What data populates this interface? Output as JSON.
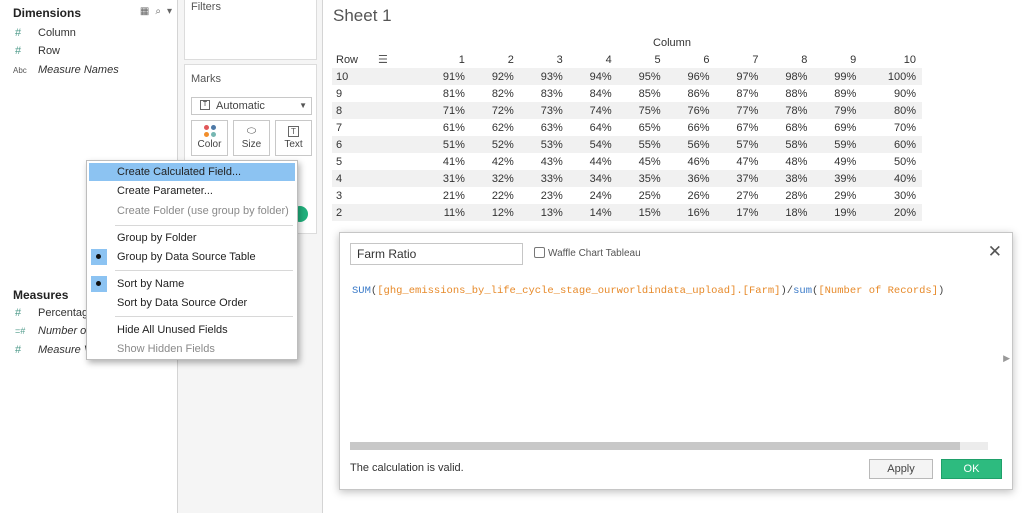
{
  "data_pane": {
    "dimensions_title": "Dimensions",
    "dimensions": [
      {
        "icon": "#",
        "label": "Column"
      },
      {
        "icon": "#",
        "label": "Row"
      },
      {
        "icon": "Abc",
        "label": "Measure Names"
      }
    ],
    "measures_title": "Measures",
    "measures": [
      {
        "icon": "#",
        "label": "Percentag"
      },
      {
        "icon": "=#",
        "label": "Number o"
      },
      {
        "icon": "#",
        "label": "Measure V"
      }
    ]
  },
  "shelves": {
    "filters_title": "Filters",
    "marks_title": "Marks",
    "mark_type": "Automatic",
    "mark_buttons": {
      "color": "Color",
      "size": "Size",
      "text": "Text"
    }
  },
  "sheet": {
    "title": "Sheet 1",
    "column_header": "Column",
    "row_header": "Row",
    "columns": [
      "1",
      "2",
      "3",
      "4",
      "5",
      "6",
      "7",
      "8",
      "9",
      "10"
    ],
    "rows": [
      {
        "row": "10",
        "cells": [
          "91%",
          "92%",
          "93%",
          "94%",
          "95%",
          "96%",
          "97%",
          "98%",
          "99%",
          "100%"
        ]
      },
      {
        "row": "9",
        "cells": [
          "81%",
          "82%",
          "83%",
          "84%",
          "85%",
          "86%",
          "87%",
          "88%",
          "89%",
          "90%"
        ]
      },
      {
        "row": "8",
        "cells": [
          "71%",
          "72%",
          "73%",
          "74%",
          "75%",
          "76%",
          "77%",
          "78%",
          "79%",
          "80%"
        ]
      },
      {
        "row": "7",
        "cells": [
          "61%",
          "62%",
          "63%",
          "64%",
          "65%",
          "66%",
          "67%",
          "68%",
          "69%",
          "70%"
        ]
      },
      {
        "row": "6",
        "cells": [
          "51%",
          "52%",
          "53%",
          "54%",
          "55%",
          "56%",
          "57%",
          "58%",
          "59%",
          "60%"
        ]
      },
      {
        "row": "5",
        "cells": [
          "41%",
          "42%",
          "43%",
          "44%",
          "45%",
          "46%",
          "47%",
          "48%",
          "49%",
          "50%"
        ]
      },
      {
        "row": "4",
        "cells": [
          "31%",
          "32%",
          "33%",
          "34%",
          "35%",
          "36%",
          "37%",
          "38%",
          "39%",
          "40%"
        ]
      },
      {
        "row": "3",
        "cells": [
          "21%",
          "22%",
          "23%",
          "24%",
          "25%",
          "26%",
          "27%",
          "28%",
          "29%",
          "30%"
        ]
      },
      {
        "row": "2",
        "cells": [
          "11%",
          "12%",
          "13%",
          "14%",
          "15%",
          "16%",
          "17%",
          "18%",
          "19%",
          "20%"
        ]
      }
    ]
  },
  "context_menu": {
    "items": [
      {
        "label": "Create Calculated Field...",
        "state": "highlighted"
      },
      {
        "label": "Create Parameter...",
        "state": "normal"
      },
      {
        "label": "Create Folder (use group by folder)",
        "state": "disabled"
      },
      {
        "label": "Group by Folder",
        "state": "normal"
      },
      {
        "label": "Group by Data Source Table",
        "state": "checked"
      },
      {
        "label": "Sort by Name",
        "state": "checked"
      },
      {
        "label": "Sort by Data Source Order",
        "state": "normal"
      },
      {
        "label": "Hide All Unused Fields",
        "state": "normal"
      },
      {
        "label": "Show Hidden Fields",
        "state": "disabled"
      }
    ]
  },
  "calc_dialog": {
    "name": "Farm Ratio",
    "data_source": "Waffle Chart Tableau",
    "formula": {
      "f1": "SUM",
      "p1": "(",
      "field1": "[ghg_emissions_by_life_cycle_stage_ourworldindata_upload].[Farm]",
      "p2": ")/",
      "f2": "sum",
      "p3": "(",
      "field2": "[Number of Records]",
      "p4": ")"
    },
    "status": "The calculation is valid.",
    "apply_label": "Apply",
    "ok_label": "OK"
  },
  "colors": {
    "accent_green": "#2dbb7f",
    "highlight_blue": "#8cc3f2",
    "field_teal": "#4e9a8a",
    "formula_fn": "#3a7ac8",
    "formula_field": "#e78a2a"
  }
}
